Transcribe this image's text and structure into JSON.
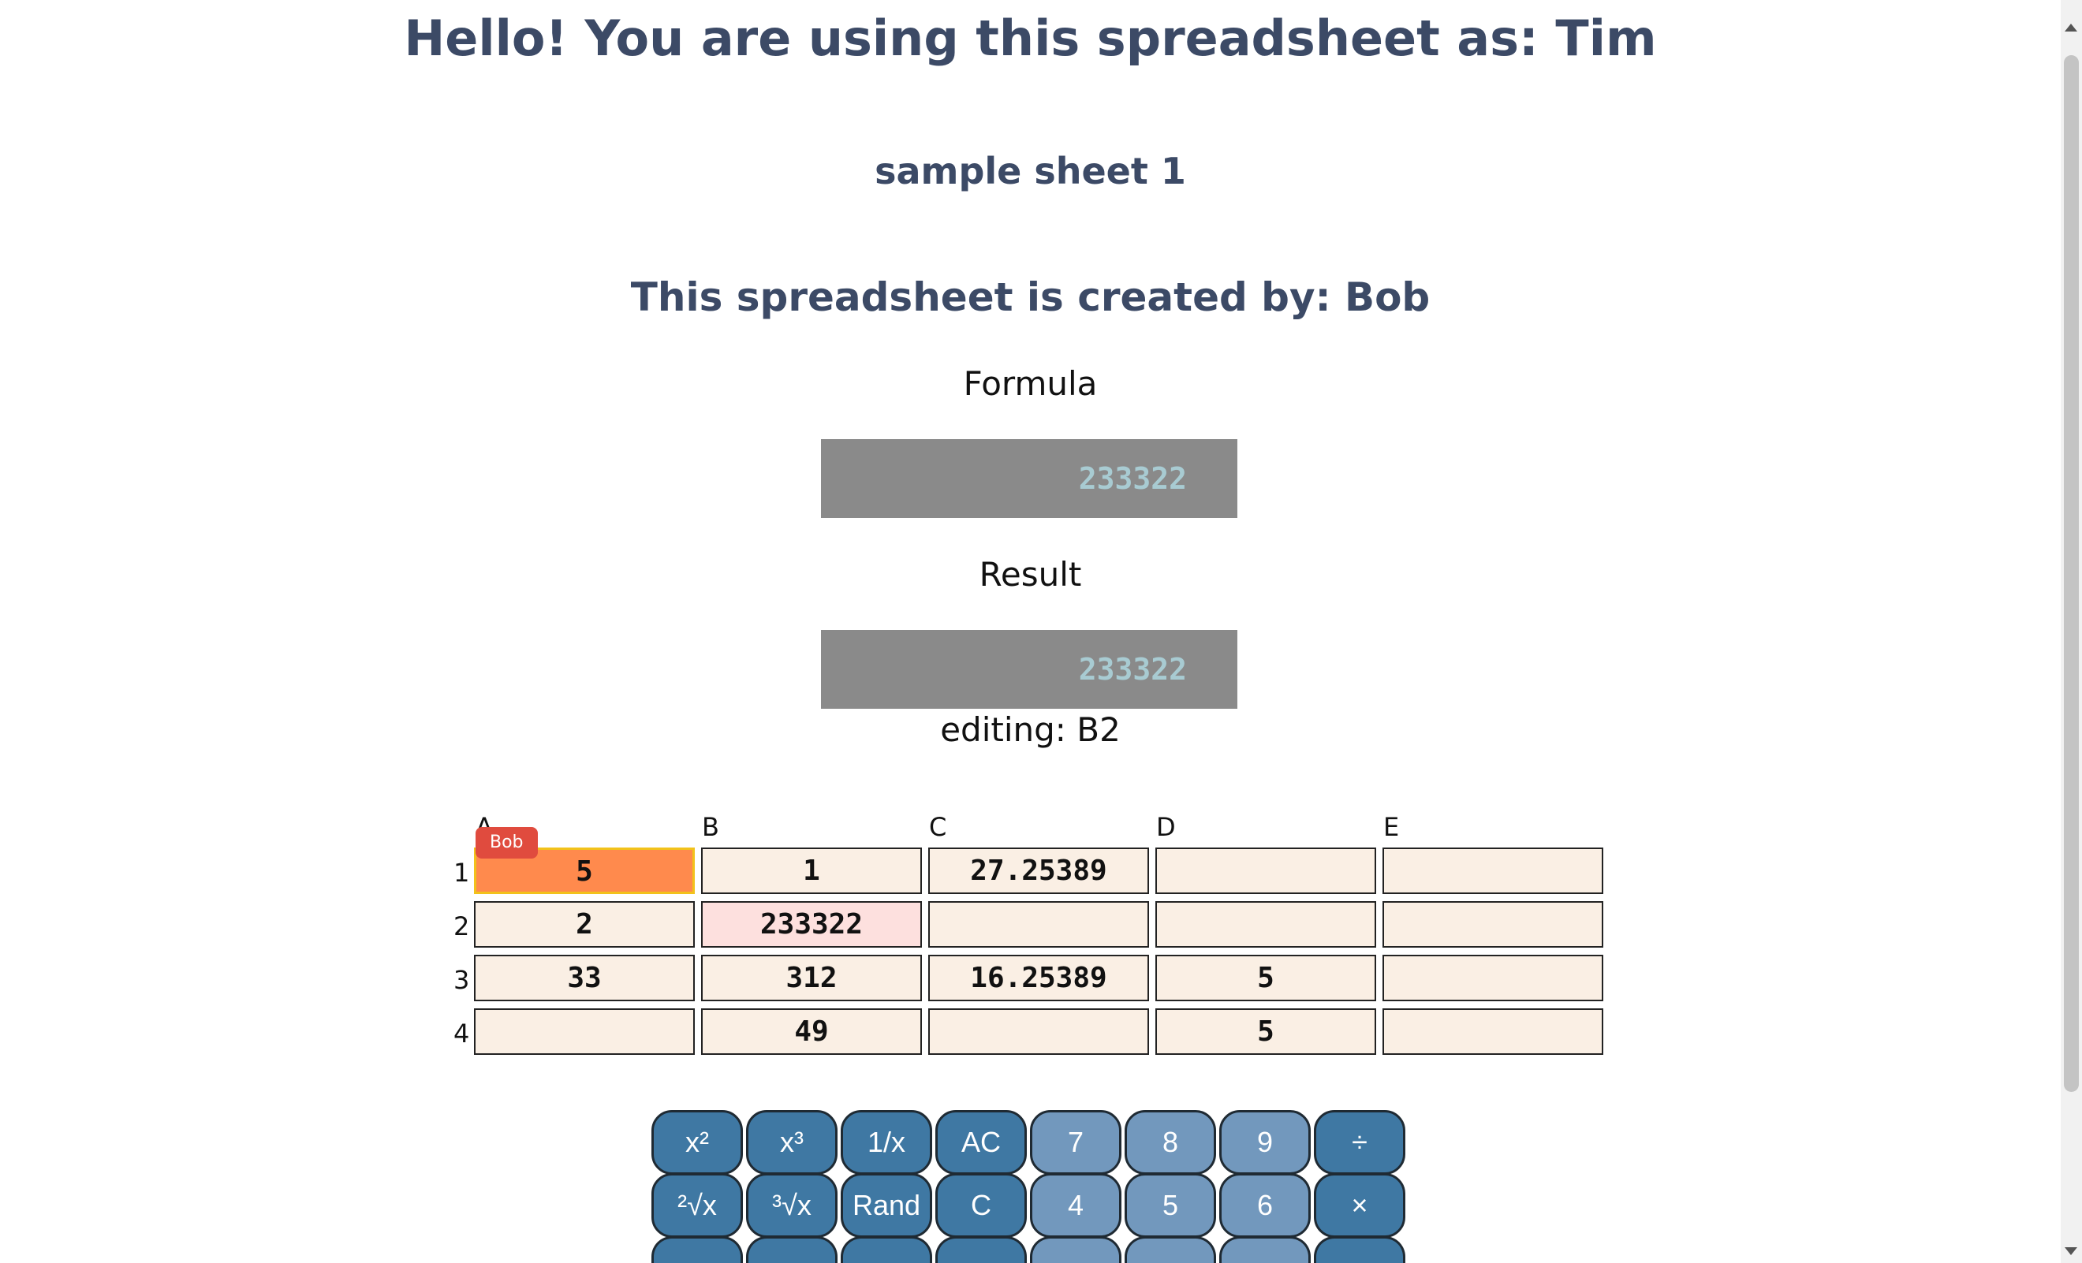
{
  "header": {
    "greeting": "Hello! You are using this spreadsheet as: Tim",
    "sheet_name": "sample sheet 1",
    "creator": "This spreadsheet is created by: Bob"
  },
  "formula": {
    "label": "Formula",
    "value": "233322"
  },
  "result": {
    "label": "Result",
    "value": "233322"
  },
  "editing": {
    "label": "editing: B2"
  },
  "grid": {
    "columns": [
      "A",
      "B",
      "C",
      "D",
      "E"
    ],
    "rows": [
      "1",
      "2",
      "3",
      "4"
    ],
    "cells": [
      [
        "5",
        "1",
        "27.25389",
        "",
        ""
      ],
      [
        "2",
        "233322",
        "",
        "",
        ""
      ],
      [
        "33",
        "312",
        "16.25389",
        "5",
        ""
      ],
      [
        "",
        "49",
        "",
        "5",
        ""
      ]
    ],
    "lock_tag": "Bob"
  },
  "calculator": {
    "row1": [
      "x²",
      "x³",
      "1/x",
      "AC",
      "7",
      "8",
      "9",
      "÷"
    ],
    "row2": [
      "²√x",
      "³√x",
      "Rand",
      "C",
      "4",
      "5",
      "6",
      "×"
    ],
    "row3": [
      "",
      "",
      "",
      "",
      "",
      "",
      "",
      ""
    ]
  },
  "colors": {
    "title": "#3c4a66",
    "locked_cell": "#ff8a4d",
    "editing_cell": "#fde0de",
    "cell": "#faefe4",
    "user_tag": "#e04b3e",
    "op_button": "#3f78a3",
    "num_button": "#7298bd"
  }
}
